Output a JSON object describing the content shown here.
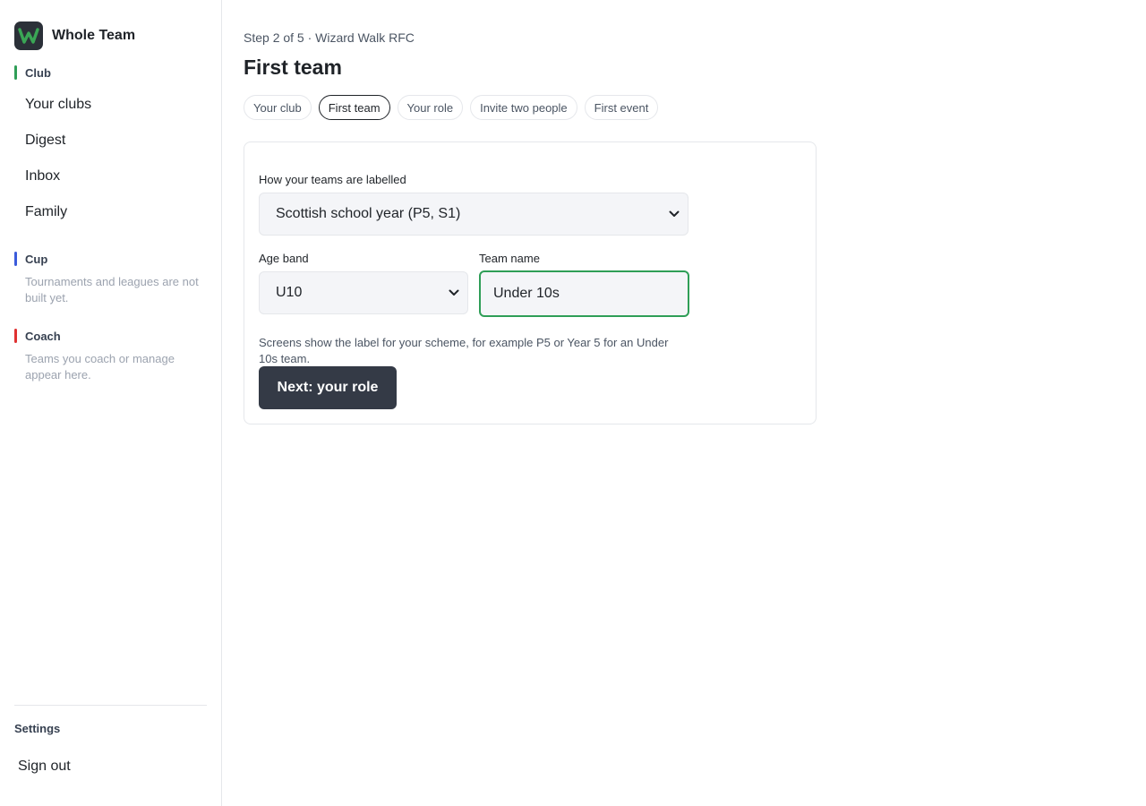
{
  "brand": {
    "name": "Whole Team",
    "accent": "#3aa655"
  },
  "sidebar": {
    "club": {
      "heading": "Club",
      "color": "#2f9e57",
      "items": [
        {
          "label": "Your clubs"
        },
        {
          "label": "Digest"
        },
        {
          "label": "Inbox"
        },
        {
          "label": "Family"
        }
      ]
    },
    "cup": {
      "heading": "Cup",
      "color": "#3b5bdb",
      "note": "Tournaments and leagues are not built yet."
    },
    "coach": {
      "heading": "Coach",
      "color": "#e03131",
      "note": "Teams you coach or manage appear here."
    },
    "settings_label": "Settings",
    "signout_label": "Sign out"
  },
  "main": {
    "step_text": "Step 2 of 5 · Wizard Walk RFC",
    "title": "First team",
    "tabs": [
      {
        "label": "Your club"
      },
      {
        "label": "First team",
        "active": true
      },
      {
        "label": "Your role"
      },
      {
        "label": "Invite two people"
      },
      {
        "label": "First event"
      }
    ],
    "form": {
      "scheme_label": "How your teams are labelled",
      "scheme_value": "Scottish school year (P5, S1)",
      "age_label": "Age band",
      "age_value": "U10",
      "team_label": "Team name",
      "team_value": "Under 10s",
      "help": "Screens show the label for your scheme, for example P5 or Year 5 for an Under 10s team.",
      "next_button": "Next: your role"
    }
  }
}
